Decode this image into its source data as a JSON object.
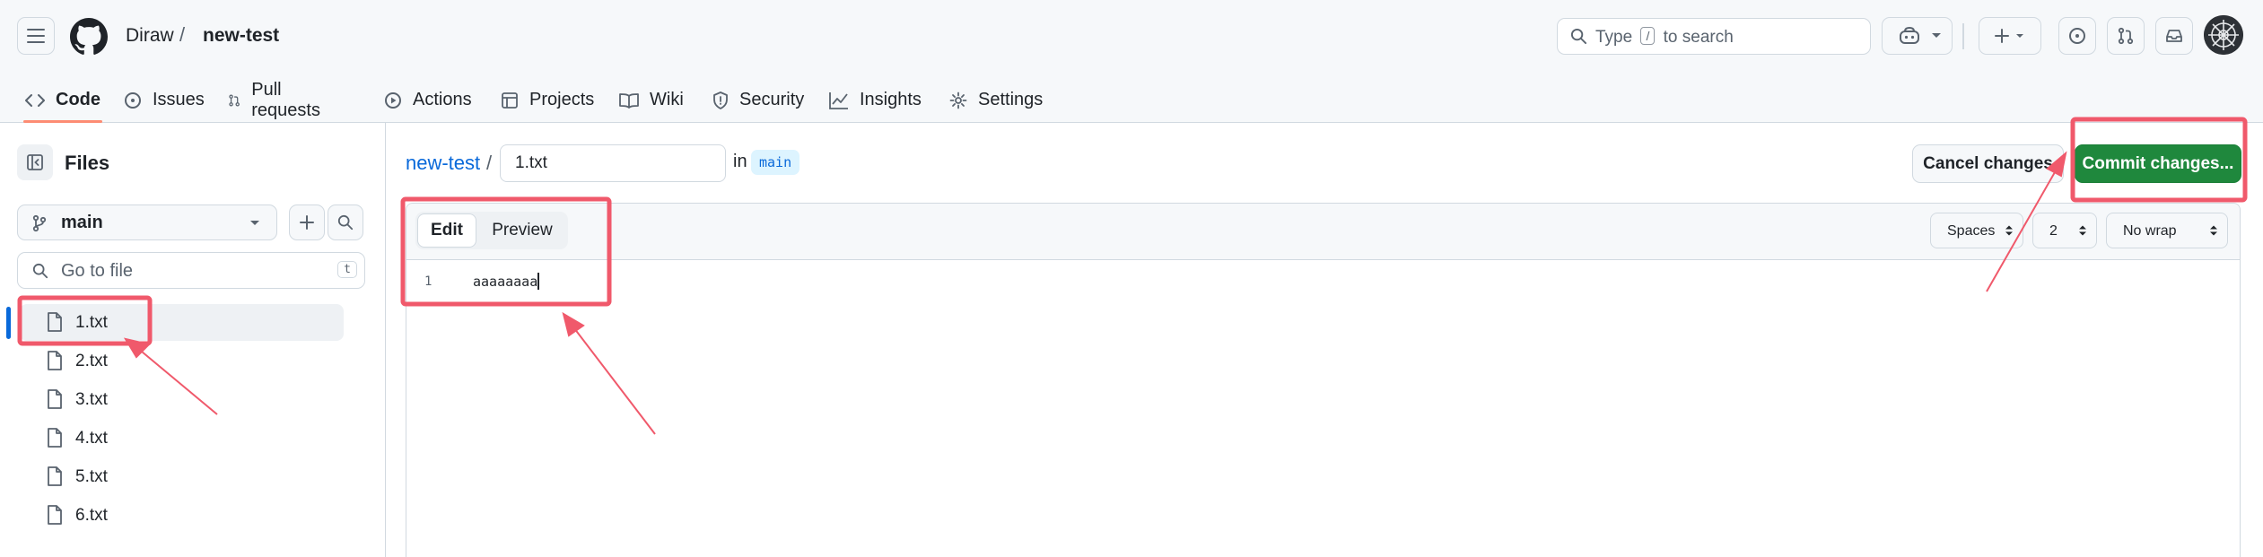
{
  "header": {
    "owner": "Diraw",
    "slash": "/",
    "repo": "new-test",
    "search_prefix": "Type",
    "search_key": "/",
    "search_suffix": "to search"
  },
  "tabs": [
    {
      "label": "Code",
      "icon": "code-icon",
      "active": true
    },
    {
      "label": "Issues",
      "icon": "issue-icon"
    },
    {
      "label": "Pull requests",
      "icon": "pull-request-icon"
    },
    {
      "label": "Actions",
      "icon": "play-icon"
    },
    {
      "label": "Projects",
      "icon": "table-icon"
    },
    {
      "label": "Wiki",
      "icon": "book-icon"
    },
    {
      "label": "Security",
      "icon": "shield-icon"
    },
    {
      "label": "Insights",
      "icon": "graph-icon"
    },
    {
      "label": "Settings",
      "icon": "gear-icon"
    }
  ],
  "sidebar": {
    "title": "Files",
    "branch": "main",
    "goto_placeholder": "Go to file",
    "goto_key": "t",
    "files": [
      "1.txt",
      "2.txt",
      "3.txt",
      "4.txt",
      "5.txt",
      "6.txt"
    ],
    "selected_file": "1.txt"
  },
  "editor": {
    "breadcrumb_repo": "new-test",
    "breadcrumb_slash": "/",
    "filename": "1.txt",
    "in_label": "in",
    "branch": "main",
    "cancel_label": "Cancel changes",
    "commit_label": "Commit changes...",
    "edit_label": "Edit",
    "preview_label": "Preview",
    "indent_mode": "Spaces",
    "indent_size": "2",
    "wrap_mode": "No wrap",
    "line_number": "1",
    "line_content": "aaaaaaaa"
  },
  "colors": {
    "accent": "#0969da",
    "commit_green": "#1f883d",
    "annotation_red": "#f0596b",
    "tab_underline": "#fd8c73"
  }
}
